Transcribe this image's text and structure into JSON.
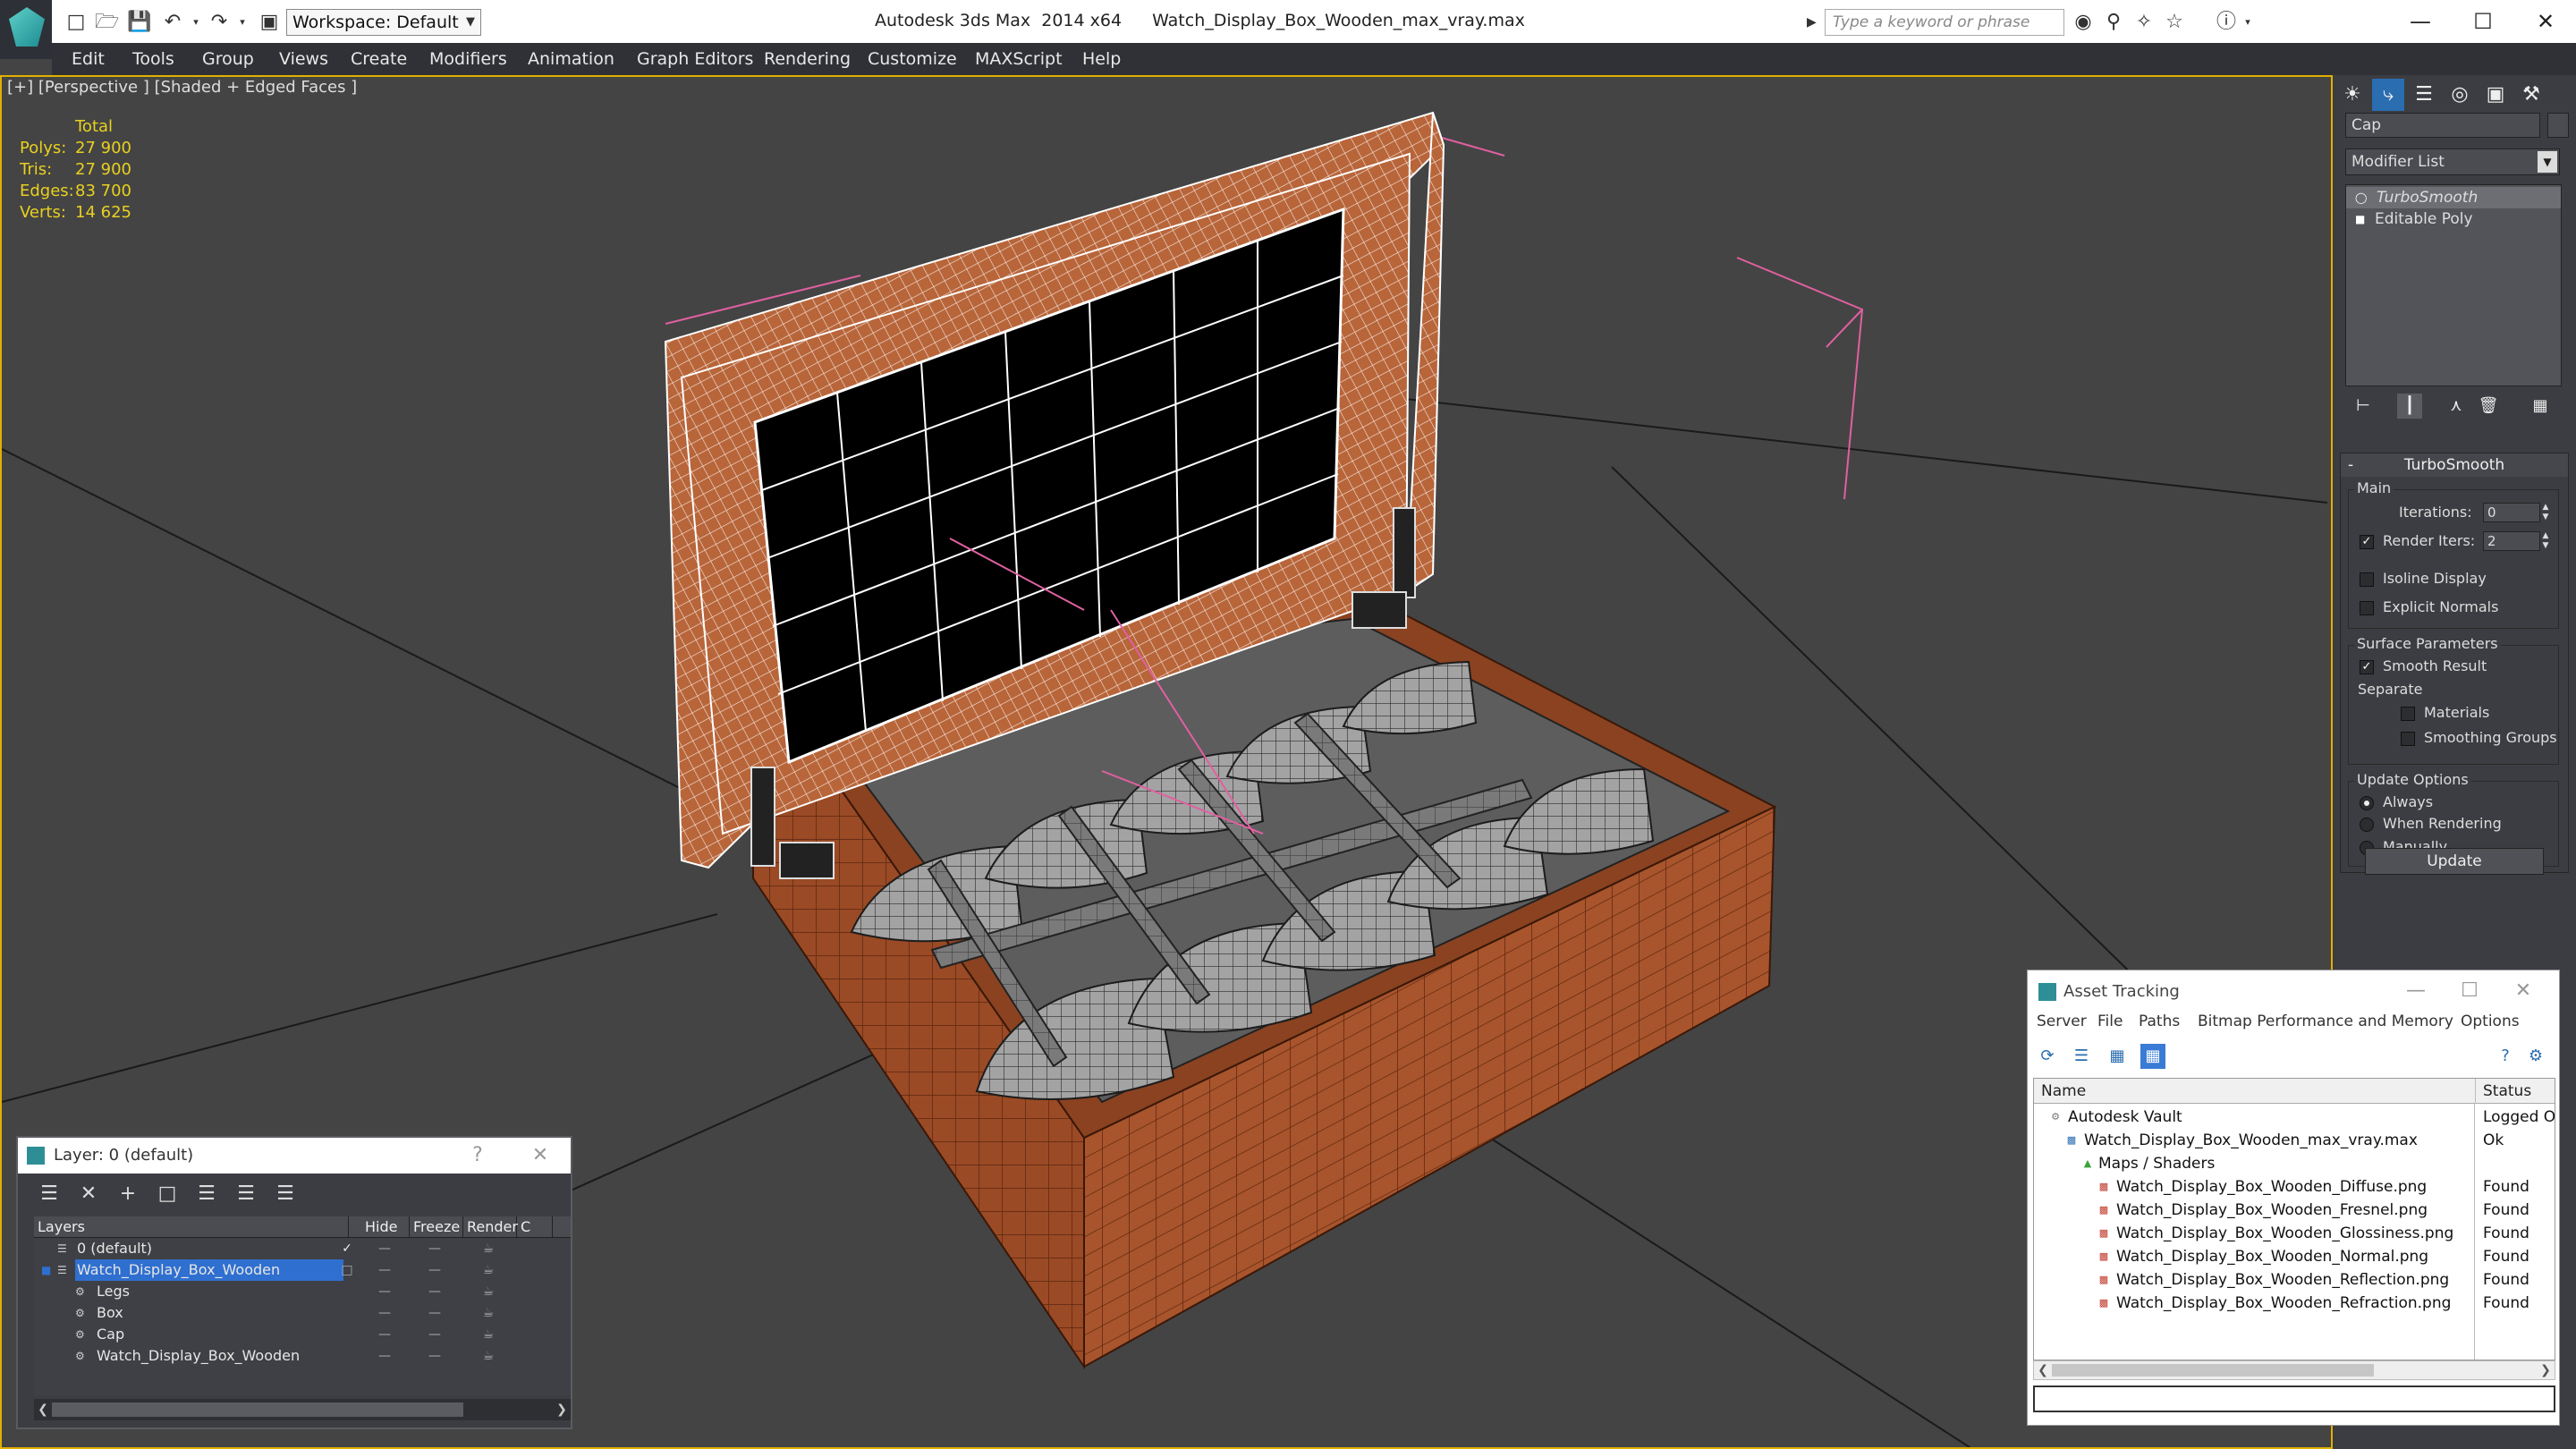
{
  "titlebar": {
    "workspace": "Workspace: Default",
    "app_title": "Autodesk 3ds Max  2014 x64",
    "file_title": "Watch_Display_Box_Wooden_max_vray.max",
    "search_placeholder": "Type a keyword or phrase",
    "minimize": "—",
    "maximize": "☐",
    "close": "✕"
  },
  "menu": [
    "Edit",
    "Tools",
    "Group",
    "Views",
    "Create",
    "Modifiers",
    "Animation",
    "Graph Editors",
    "Rendering",
    "Customize",
    "MAXScript",
    "Help"
  ],
  "viewport": {
    "label": "[+] [Perspective ] [Shaded + Edged Faces ]",
    "stats": {
      "header": "Total",
      "rows": [
        {
          "label": "Polys:",
          "value": "27 900"
        },
        {
          "label": "Tris:",
          "value": "27 900"
        },
        {
          "label": "Edges:",
          "value": "83 700"
        },
        {
          "label": "Verts:",
          "value": "14 625"
        }
      ]
    }
  },
  "command_panel": {
    "object_name": "Cap",
    "modifier_list": "Modifier List",
    "stack": [
      "TurboSmooth",
      "Editable Poly"
    ],
    "rollout_title": "TurboSmooth",
    "main_group": "Main",
    "iterations_label": "Iterations:",
    "iterations_value": "0",
    "render_iters_label": "Render Iters:",
    "render_iters_value": "2",
    "render_iters_checked": true,
    "isoline_label": "Isoline Display",
    "explicit_normals_label": "Explicit Normals",
    "surface_group": "Surface Parameters",
    "smooth_result_label": "Smooth Result",
    "separate_label": "Separate",
    "materials_label": "Materials",
    "smoothing_groups_label": "Smoothing Groups",
    "update_group": "Update Options",
    "always_label": "Always",
    "when_rendering_label": "When Rendering",
    "manually_label": "Manually",
    "update_button": "Update"
  },
  "layer_dialog": {
    "title": "Layer: 0 (default)",
    "help": "?",
    "close": "✕",
    "columns": [
      "Layers",
      "Hide",
      "Freeze",
      "Render",
      "C"
    ],
    "rows": [
      {
        "name": "0 (default)",
        "indent": 0,
        "current": true
      },
      {
        "name": "Watch_Display_Box_Wooden",
        "indent": 0,
        "selected": true
      },
      {
        "name": "Legs",
        "indent": 1
      },
      {
        "name": "Box",
        "indent": 1
      },
      {
        "name": "Cap",
        "indent": 1
      },
      {
        "name": "Watch_Display_Box_Wooden",
        "indent": 1
      }
    ],
    "check": "✓"
  },
  "asset_dialog": {
    "title": "Asset Tracking",
    "menu": [
      "Server",
      "File",
      "Paths",
      "Bitmap Performance and Memory",
      "Options"
    ],
    "columns": [
      "Name",
      "Status"
    ],
    "rows": [
      {
        "name": "Autodesk Vault",
        "status": "Logged Ou",
        "level": 0
      },
      {
        "name": "Watch_Display_Box_Wooden_max_vray.max",
        "status": "Ok",
        "level": 1
      },
      {
        "name": "Maps / Shaders",
        "status": "",
        "level": 2
      },
      {
        "name": "Watch_Display_Box_Wooden_Diffuse.png",
        "status": "Found",
        "level": 3
      },
      {
        "name": "Watch_Display_Box_Wooden_Fresnel.png",
        "status": "Found",
        "level": 3
      },
      {
        "name": "Watch_Display_Box_Wooden_Glossiness.png",
        "status": "Found",
        "level": 3
      },
      {
        "name": "Watch_Display_Box_Wooden_Normal.png",
        "status": "Found",
        "level": 3
      },
      {
        "name": "Watch_Display_Box_Wooden_Reflection.png",
        "status": "Found",
        "level": 3
      },
      {
        "name": "Watch_Display_Box_Wooden_Refraction.png",
        "status": "Found",
        "level": 3
      }
    ]
  },
  "colors": {
    "wood": "#9a4a25",
    "wood_dark": "#6b2f14",
    "cushion": "#9a9a9a",
    "stats_yellow": "#e8d020",
    "selection_blue": "#2f6fd0"
  }
}
